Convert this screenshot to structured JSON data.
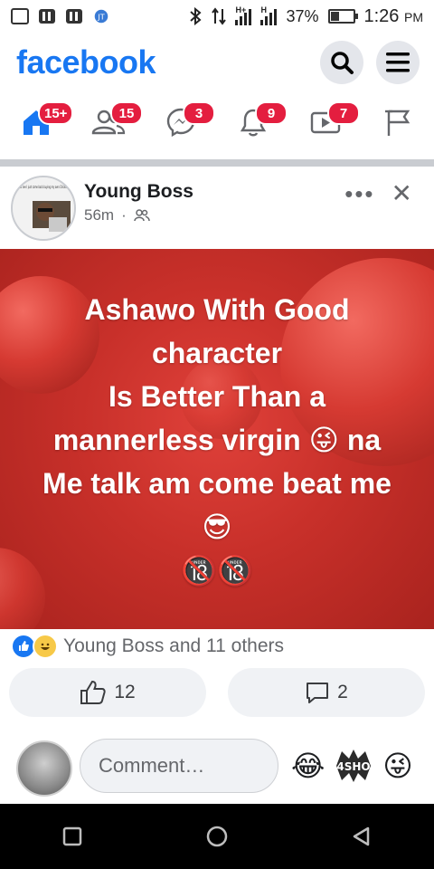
{
  "status_bar": {
    "signal_labels": [
      "H+",
      "H"
    ],
    "battery": "37%",
    "battery_level": 0.37,
    "time": "1:26",
    "ampm": "PM"
  },
  "header": {
    "brand": "facebook",
    "brand_color": "#1877f2",
    "search_icon": "search-icon",
    "menu_icon": "menu-icon"
  },
  "nav": {
    "items": [
      {
        "name": "home",
        "badge": "15+",
        "active": true
      },
      {
        "name": "friends",
        "badge": "15"
      },
      {
        "name": "messenger",
        "badge": "3"
      },
      {
        "name": "notifications",
        "badge": "9"
      },
      {
        "name": "watch",
        "badge": "7"
      },
      {
        "name": "pages",
        "badge": ""
      }
    ],
    "badge_color": "#e41e3f"
  },
  "post": {
    "author": "Young Boss",
    "avatar_caption": "Lol see I just came back buying my own Chicken",
    "time": "56m",
    "separator": "·",
    "audience_icon": "friends-audience-icon",
    "more": "•••",
    "close": "✕",
    "text_lines": [
      "Ashawo With Good",
      "character",
      "Is Better Than a",
      "mannerless virgin 😜 na",
      "Me talk am come beat me",
      "😎",
      "🔞🔞"
    ],
    "background_color": "#c8302a",
    "reactions_text": "Young Boss and 11 others",
    "like_count": "12",
    "comment_count": "2"
  },
  "comment_bar": {
    "placeholder": "Comment…",
    "emojis": [
      "😂",
      "😜"
    ],
    "sticker_text": "4SHO"
  },
  "system_nav": {
    "recents_icon": "square-icon",
    "home_icon": "circle-icon",
    "back_icon": "triangle-back-icon"
  }
}
